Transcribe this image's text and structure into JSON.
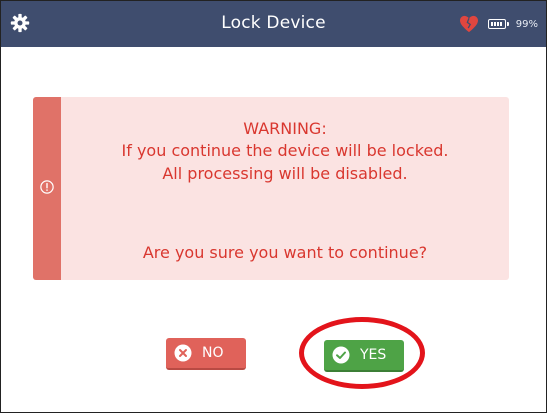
{
  "header": {
    "title": "Lock Device",
    "left_icon": "gear-icon",
    "status": {
      "heart_icon": "broken-heart-icon",
      "battery_icon": "battery-icon",
      "battery_percent": "99%"
    }
  },
  "alert": {
    "icon": "exclamation-circle-icon",
    "warning_title": "WARNING:",
    "line1": "If you continue the device will be locked.",
    "line2": "All processing will be disabled.",
    "question": "Are you sure you want to continue?"
  },
  "buttons": {
    "no_label": "NO",
    "no_icon": "x-circle-icon",
    "yes_label": "YES",
    "yes_icon": "check-circle-icon"
  },
  "colors": {
    "header_bg": "#3f4d6e",
    "alert_bg": "#fbe3e2",
    "alert_stripe": "#e07268",
    "alert_text": "#d9372f",
    "no_button": "#e0625a",
    "yes_button": "#4ea346",
    "highlight": "#e3141b"
  }
}
